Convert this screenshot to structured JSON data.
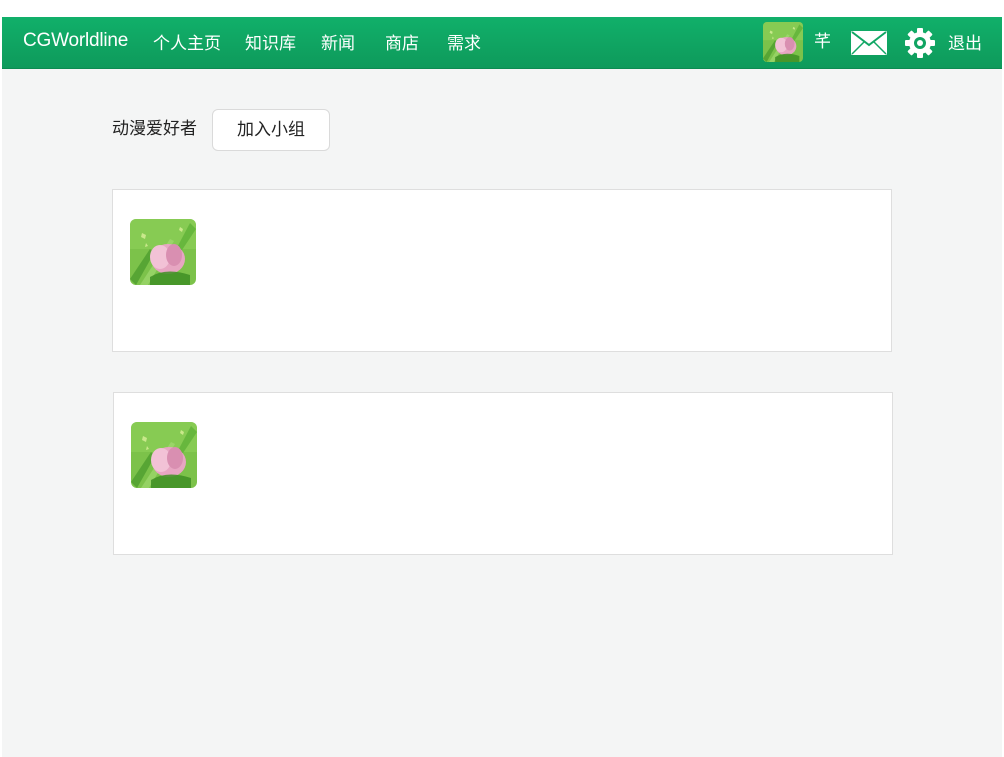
{
  "navbar": {
    "brand": "CGWorldline",
    "items": [
      {
        "id": "home",
        "label": "个人主页"
      },
      {
        "id": "knowledge",
        "label": "知识库"
      },
      {
        "id": "news",
        "label": "新闻"
      },
      {
        "id": "shop",
        "label": "商店"
      },
      {
        "id": "demand",
        "label": "需求"
      }
    ],
    "user_name": "芊",
    "logout_label": "退出"
  },
  "group": {
    "name": "动漫爱好者",
    "join_label": "加入小组"
  },
  "posts": [
    {
      "author_avatar": "tulip-avatar"
    },
    {
      "author_avatar": "tulip-avatar"
    }
  ],
  "colors": {
    "nav_green": "#11b06a",
    "page_background": "#f4f5f5",
    "card_background": "#ffffff",
    "card_border": "#dedede"
  },
  "icons": {
    "mail": "mail-icon",
    "settings": "gear-icon",
    "avatar": "avatar"
  }
}
